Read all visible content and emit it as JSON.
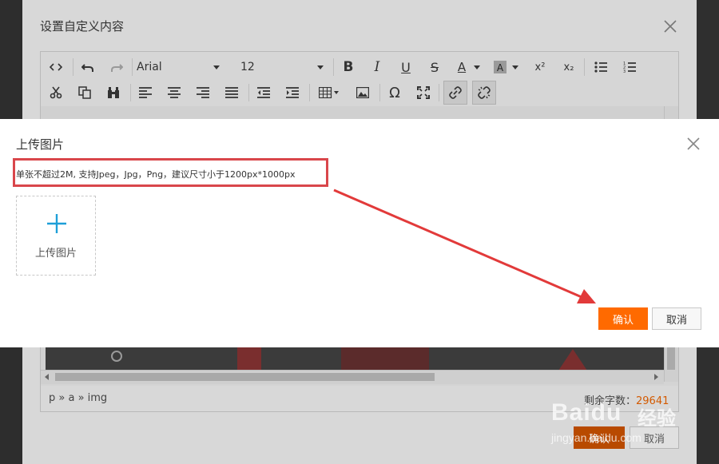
{
  "outer_dialog": {
    "title": "设置自定义内容",
    "toolbar": {
      "font": "Arial",
      "size": "12"
    },
    "status_path": "p » a » img",
    "word_count_label": "剩余字数：",
    "word_count_value": "29641",
    "confirm_label": "确认",
    "cancel_label": "取消"
  },
  "upload_dialog": {
    "title": "上传图片",
    "hint": "单张不超过2M, 支持Jpeg，Jpg，Png，建议尺寸小于1200px*1000px",
    "tile_label": "上传图片",
    "confirm_label": "确认",
    "cancel_label": "取消"
  },
  "colors": {
    "accent": "#ff6a00",
    "highlight_box": "#d9464b",
    "plus": "#1e9fd8",
    "word_count": "#d35a00"
  },
  "icons": [
    "close-icon",
    "plus-icon",
    "source-code-icon",
    "undo-icon",
    "redo-icon",
    "bold-icon",
    "italic-icon",
    "underline-icon",
    "strikethrough-icon",
    "font-color-icon",
    "background-color-icon",
    "superscript-icon",
    "subscript-icon",
    "bullet-list-icon",
    "numbered-list-icon",
    "cut-icon",
    "copy-icon",
    "find-icon",
    "align-left-icon",
    "align-center-icon",
    "align-right-icon",
    "justify-icon",
    "outdent-icon",
    "indent-icon",
    "table-icon",
    "image-icon",
    "special-char-icon",
    "fullscreen-icon",
    "link-icon",
    "unlink-icon"
  ],
  "watermark": {
    "brand": "Baidu",
    "cn": "经验",
    "url": "jingyan.baidu.com"
  }
}
